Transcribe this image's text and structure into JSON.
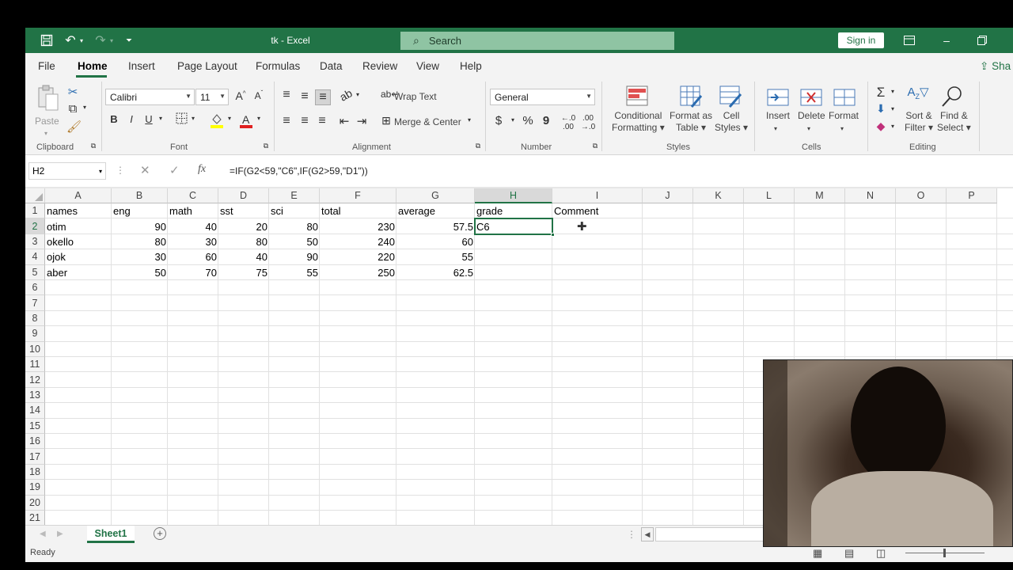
{
  "titlebar": {
    "doc_title": "tk  -  Excel",
    "search_placeholder": "Search",
    "signin_label": "Sign in"
  },
  "tabs": [
    "File",
    "Home",
    "Insert",
    "Page Layout",
    "Formulas",
    "Data",
    "Review",
    "View",
    "Help"
  ],
  "active_tab": "Home",
  "share_label": "Sha",
  "ribbon": {
    "clipboard": {
      "paste": "Paste",
      "label": "Clipboard"
    },
    "font": {
      "name": "Calibri",
      "size": "11",
      "label": "Font",
      "bold": "B",
      "italic": "I",
      "underline": "U"
    },
    "alignment": {
      "wrap": "Wrap Text",
      "merge": "Merge & Center",
      "label": "Alignment"
    },
    "number": {
      "format": "General",
      "label": "Number",
      "currency": "$",
      "percent": "%",
      "comma": "9"
    },
    "styles": {
      "conditional": [
        "Conditional",
        "Formatting"
      ],
      "format_table": [
        "Format as",
        "Table"
      ],
      "cell_styles": [
        "Cell",
        "Styles"
      ],
      "label": "Styles"
    },
    "cells": {
      "insert": "Insert",
      "delete": "Delete",
      "format": "Format",
      "label": "Cells"
    },
    "editing": {
      "sort": [
        "Sort &",
        "Filter"
      ],
      "find": [
        "Find &",
        "Select"
      ],
      "label": "Editing"
    }
  },
  "formula_bar": {
    "name_box": "H2",
    "formula": "=IF(G2<59,\"C6\",IF(G2>59,\"D1\"))",
    "fx": "fx"
  },
  "columns": [
    "A",
    "B",
    "C",
    "D",
    "E",
    "F",
    "G",
    "H",
    "I",
    "J",
    "K",
    "L",
    "M",
    "N",
    "O",
    "P"
  ],
  "rows": [
    "1",
    "2",
    "3",
    "4",
    "5",
    "6",
    "7",
    "8",
    "9",
    "10",
    "11",
    "12",
    "13",
    "14",
    "15",
    "16",
    "17",
    "18",
    "19",
    "20",
    "21"
  ],
  "cells": {
    "row1": [
      "names",
      "eng",
      "math",
      "sst",
      "sci",
      "total",
      "average",
      "grade",
      "Comment"
    ],
    "row2": [
      "otim",
      "90",
      "40",
      "20",
      "80",
      "230",
      "57.5",
      "C6"
    ],
    "row3": [
      "okello",
      "80",
      "30",
      "80",
      "50",
      "240",
      "60"
    ],
    "row4": [
      "ojok",
      "30",
      "60",
      "40",
      "90",
      "220",
      "55"
    ],
    "row5": [
      "aber",
      "50",
      "70",
      "75",
      "55",
      "250",
      "62.5"
    ]
  },
  "sheet_tab": "Sheet1",
  "status": {
    "ready": "Ready"
  },
  "colors": {
    "excel_green": "#217346",
    "ribbon_bg": "#f3f3f3"
  }
}
